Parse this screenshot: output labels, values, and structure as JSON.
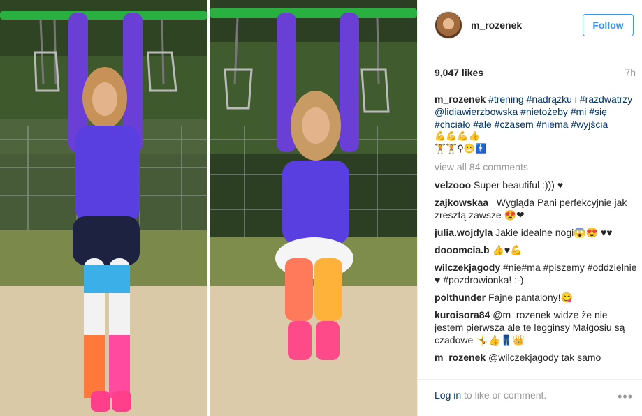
{
  "profile": {
    "username": "m_rozenek",
    "follow_label": "Follow"
  },
  "post": {
    "likes": "9,047 likes",
    "time": "7h"
  },
  "caption": {
    "user": "m_rozenek",
    "tags": [
      "#trening",
      "#nadrążku",
      "i",
      "#razdwatrzy",
      "@lidiawierzbowska",
      "#nietożeby",
      "#mi",
      "#się",
      "#chciało",
      "#ale",
      "#czasem",
      "#niema",
      "#wyjścia"
    ],
    "emoji_line1": "💪💪💪👍",
    "emoji_line2": "🏋🏋♀😬🚹"
  },
  "view_all": "view all 84 comments",
  "comments": [
    {
      "user": "velzooo",
      "text": "Super beautiful :))) ♥"
    },
    {
      "user": "zajkowskaa_",
      "text": "Wygląda Pani perfekcyjnie jak zresztą zawsze 😍❤"
    },
    {
      "user": "julia.wojdyla",
      "text": "Jakie idealne nogi😱😍 ♥♥"
    },
    {
      "user": "dooomcia.b",
      "text": "👍♥💪"
    },
    {
      "user": "wilczekjagody",
      "text": "#nie#ma #piszemy #oddzielnie ♥ #pozdrowionka! :-)"
    },
    {
      "user": "polthunder",
      "text": "Fajne pantalony!😋"
    },
    {
      "user": "kuroisora84",
      "text": "@m_rozenek widzę że nie jestem pierwsza ale te legginsy Małgosiu są czadowe 🤸👍👖👑"
    },
    {
      "user": "m_rozenek",
      "text": "@wilczekjagody tak samo"
    }
  ],
  "footer": {
    "login_link": "Log in",
    "login_text": " to like or comment.",
    "more": "•••"
  },
  "colors": {
    "accent": "#3897f0",
    "tag": "#003569",
    "muted": "#999999"
  }
}
